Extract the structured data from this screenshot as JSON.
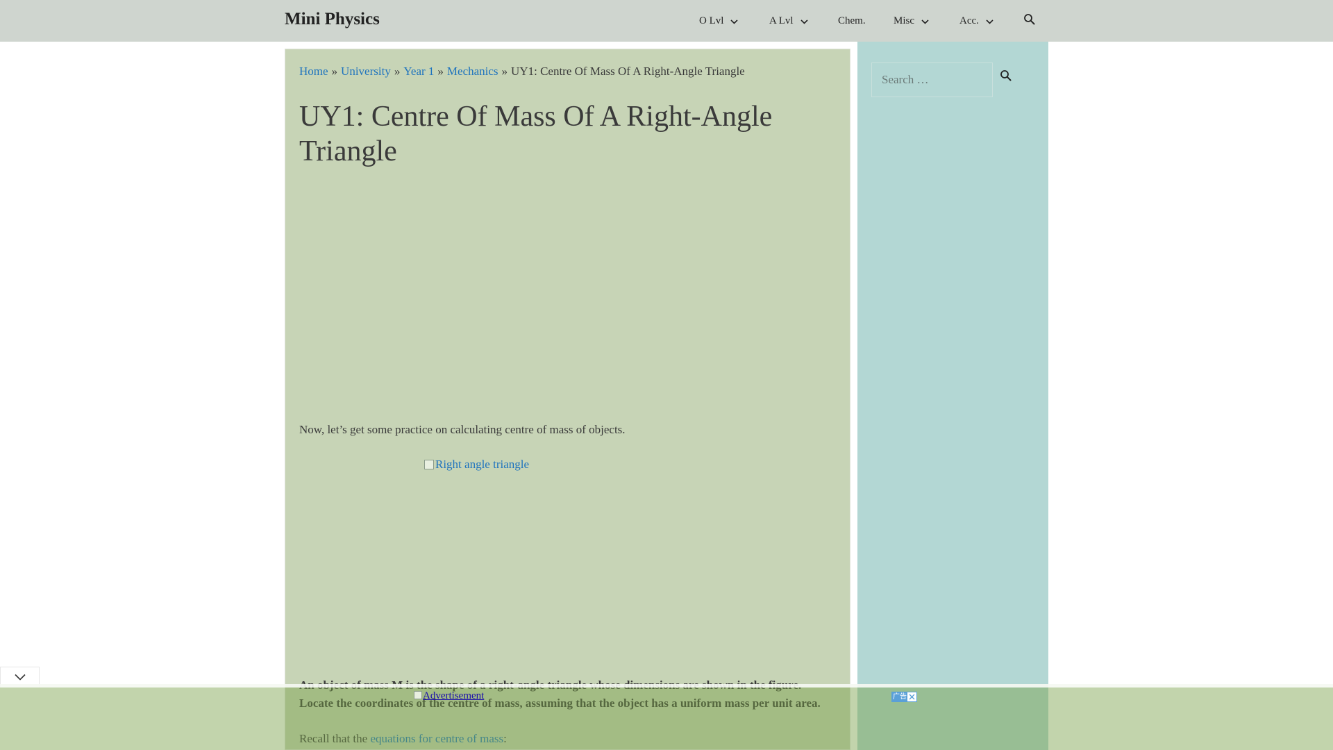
{
  "site": {
    "title": "Mini Physics"
  },
  "nav": {
    "items": [
      {
        "label": "O Lvl",
        "has_dropdown": true
      },
      {
        "label": "A Lvl",
        "has_dropdown": true
      },
      {
        "label": "Chem.",
        "has_dropdown": false
      },
      {
        "label": "Misc",
        "has_dropdown": true
      },
      {
        "label": "Acc.",
        "has_dropdown": true
      }
    ],
    "search_icon": "search-icon"
  },
  "breadcrumb": {
    "items": [
      "Home",
      "University",
      "Year 1",
      "Mechanics"
    ],
    "separator": "»",
    "current": "UY1: Centre Of Mass Of A Right-Angle Triangle"
  },
  "article": {
    "title": "UY1: Centre Of Mass Of A Right-Angle Triangle",
    "intro": "Now, let’s get some practice on calculating centre of mass of objects.",
    "figure_alt": "Right angle triangle",
    "problem_line1": "An object of mass M is the shape of a right-angle triangle whose dimensions are shown in the figure.",
    "problem_line2": "Locate the coordinates of the centre of mass, assuming that the object has a uniform mass per unit area.",
    "recall_prefix": "Recall that the ",
    "recall_link": "equations for centre of mass",
    "recall_suffix": ":"
  },
  "sidebar": {
    "search_placeholder": "Search …",
    "search_button_icon": "search-icon"
  },
  "ad": {
    "link_text": "Advertisement",
    "label": "广告",
    "close_icon": "close-icon"
  },
  "collapse_icon": "chevron-down-icon",
  "colors": {
    "header_bg": "#cfd5cf",
    "content_bg": "#c7d4b6",
    "sidebar_bg": "#b3d7d4",
    "link": "#1e73be",
    "text": "#3a3a3a"
  }
}
